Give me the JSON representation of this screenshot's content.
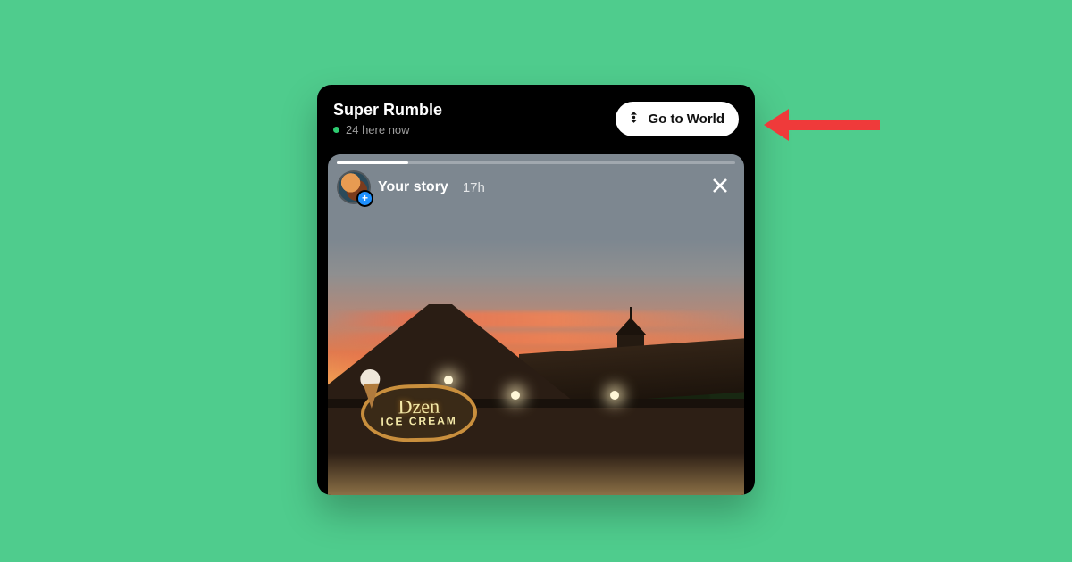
{
  "header": {
    "title": "Super Rumble",
    "status": "24 here now",
    "button_label": "Go to World"
  },
  "story": {
    "owner_label": "Your story",
    "timestamp": "17h",
    "sign_line1": "Dzen",
    "sign_line2": "ICE CREAM"
  }
}
